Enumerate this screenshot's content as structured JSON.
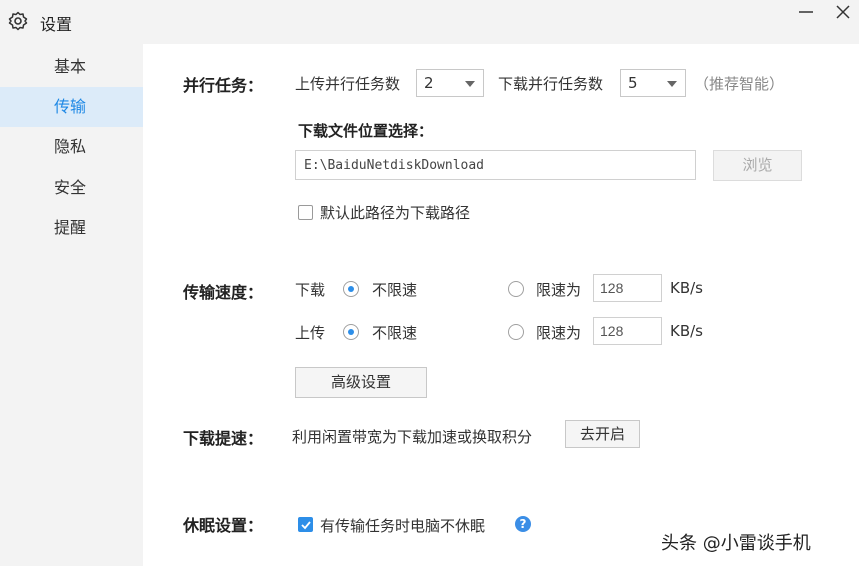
{
  "window": {
    "title": "设置",
    "icon": "gear-icon"
  },
  "sidebar": {
    "items": [
      {
        "label": "基本",
        "active": false
      },
      {
        "label": "传输",
        "active": true
      },
      {
        "label": "隐私",
        "active": false
      },
      {
        "label": "安全",
        "active": false
      },
      {
        "label": "提醒",
        "active": false
      }
    ]
  },
  "parallel": {
    "label": "并行任务：",
    "upload_label": "上传并行任务数",
    "upload_value": "2",
    "download_label": "下载并行任务数",
    "download_value": "5",
    "hint": "（推荐智能）"
  },
  "download_location": {
    "label": "下载文件位置选择：",
    "path": "E:\\BaiduNetdiskDownload",
    "browse_label": "浏览",
    "default_checkbox_label": "默认此路径为下载路径",
    "default_checked": false
  },
  "speed": {
    "label": "传输速度：",
    "download": {
      "label": "下载",
      "unlimited_label": "不限速",
      "limit_label": "限速为",
      "limit_value": "128",
      "unit": "KB/s",
      "unlimited_selected": true
    },
    "upload": {
      "label": "上传",
      "unlimited_label": "不限速",
      "limit_label": "限速为",
      "limit_value": "128",
      "unit": "KB/s",
      "unlimited_selected": true
    },
    "advanced_label": "高级设置"
  },
  "boost": {
    "label": "下载提速：",
    "description": "利用闲置带宽为下载加速或换取积分",
    "button_label": "去开启"
  },
  "sleep": {
    "label": "休眠设置：",
    "checkbox_label": "有传输任务时电脑不休眠",
    "checked": true
  },
  "watermark": "头条 @小雷谈手机",
  "colors": {
    "accent": "#2d8ee8",
    "sidebar_bg": "#f3f3f3",
    "active_bg": "#dcebf9"
  }
}
